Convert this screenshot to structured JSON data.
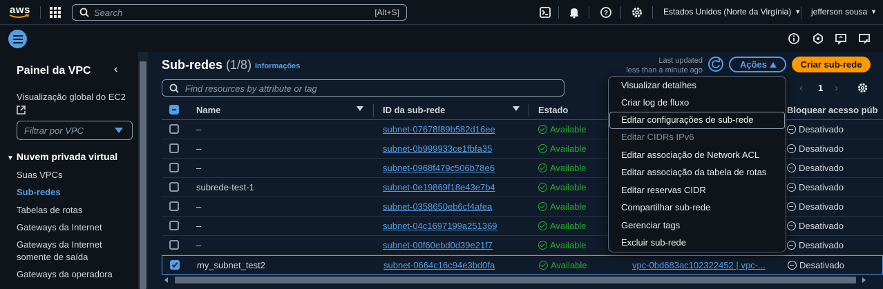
{
  "topbar": {
    "logo": "aws",
    "search_placeholder": "Search",
    "search_shortcut": "[Alt+S]",
    "region": "Estados Unidos (Norte da Virgínia)",
    "user": "jefferson sousa",
    "icons": [
      "cloudshell-icon",
      "bell-icon",
      "help-icon",
      "gear-icon"
    ]
  },
  "secondary_bar": {
    "icons": [
      "info-icon",
      "notes-icon",
      "feedback-icon",
      "shortcuts-icon"
    ]
  },
  "sidebar": {
    "title": "Painel da VPC",
    "ec2_global": "Visualização global do EC2",
    "filter_placeholder": "Filtrar por VPC",
    "section": "Nuvem privada virtual",
    "items": [
      {
        "label": "Suas VPCs",
        "active": false
      },
      {
        "label": "Sub-redes",
        "active": true
      },
      {
        "label": "Tabelas de rotas",
        "active": false
      },
      {
        "label": "Gateways da Internet",
        "active": false
      },
      {
        "label": "Gateways da Internet somente de saída",
        "active": false
      },
      {
        "label": "Gateways da operadora",
        "active": false
      }
    ]
  },
  "header": {
    "title": "Sub-redes",
    "count": "(1/8)",
    "info_link": "Informações",
    "last_updated_label": "Last updated",
    "last_updated_value": "less than a minute ago",
    "actions_label": "Ações",
    "create_label": "Criar sub-rede"
  },
  "table_search": {
    "placeholder": "Find resources by attribute or tag"
  },
  "pagination": {
    "page": "1"
  },
  "table": {
    "columns": [
      "Name",
      "ID da sub-rede",
      "Estado",
      "Bloquear acesso púb"
    ],
    "rows": [
      {
        "name": "–",
        "id": "subnet-07678f89b582d16ee",
        "state": "Available",
        "vpc": "",
        "block": "Desativado",
        "selected": false
      },
      {
        "name": "–",
        "id": "subnet-0b999933ce1fbfa35",
        "state": "Available",
        "vpc": "",
        "block": "Desativado",
        "selected": false
      },
      {
        "name": "–",
        "id": "subnet-0968f479c506b78e6",
        "state": "Available",
        "vpc": "",
        "block": "Desativado",
        "selected": false
      },
      {
        "name": "subrede-test-1",
        "id": "subnet-0e19869f18e43e7b4",
        "state": "Available",
        "vpc": "",
        "block": "Desativado",
        "selected": false
      },
      {
        "name": "–",
        "id": "subnet-0358650eb6cf4afea",
        "state": "Available",
        "vpc": "",
        "block": "Desativado",
        "selected": false
      },
      {
        "name": "–",
        "id": "subnet-04c1697199a251369",
        "state": "Available",
        "vpc": "",
        "block": "Desativado",
        "selected": false
      },
      {
        "name": "–",
        "id": "subnet-00f60ebd0d39e21f7",
        "state": "Available",
        "vpc": "",
        "block": "Desativado",
        "selected": false
      },
      {
        "name": "my_subnet_test2",
        "id": "subnet-0664c16c94e3bd0fa",
        "state": "Available",
        "vpc": "vpc-0bd683ac102322452 | vpc-...",
        "block": "Desativado",
        "selected": true
      }
    ]
  },
  "actions_menu": {
    "items": [
      {
        "label": "Visualizar detalhes",
        "disabled": false
      },
      {
        "label": "Criar log de fluxo",
        "disabled": false
      },
      {
        "label": "Editar configurações de sub-rede",
        "disabled": false,
        "highlighted": true
      },
      {
        "label": "Editar CIDRs IPv6",
        "disabled": true
      },
      {
        "label": "Editar associação de Network ACL",
        "disabled": false
      },
      {
        "label": "Editar associação da tabela de rotas",
        "disabled": false
      },
      {
        "label": "Editar reservas CIDR",
        "disabled": false
      },
      {
        "label": "Compartilhar sub-rede",
        "disabled": false
      },
      {
        "label": "Gerenciar tags",
        "disabled": false
      },
      {
        "label": "Excluir sub-rede",
        "disabled": false
      }
    ]
  },
  "colors": {
    "accent": "#539fe5",
    "primary_button": "#ff9900",
    "available": "#29ad32",
    "bg": "#0f1b2a"
  }
}
